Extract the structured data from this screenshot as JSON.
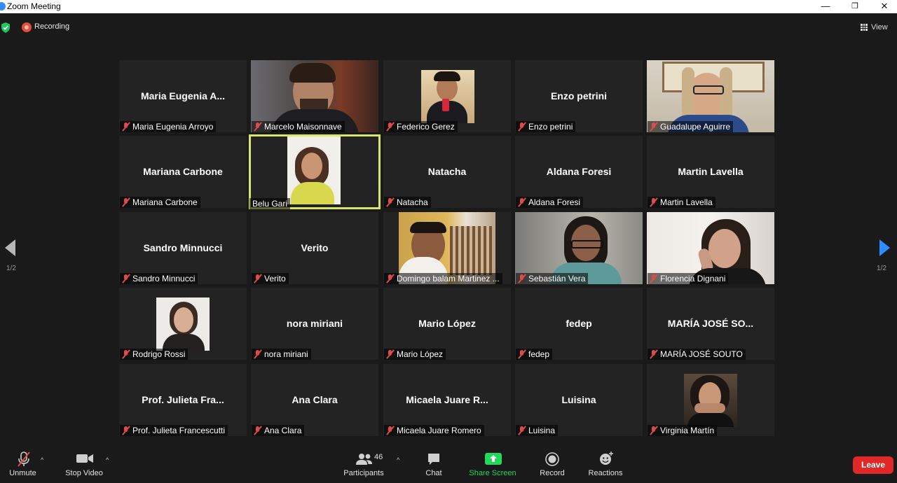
{
  "window": {
    "title": "Zoom Meeting",
    "minimize_icon": "—",
    "restore_icon": "❐",
    "close_icon": "✕"
  },
  "meeting": {
    "recording_label": "Recording",
    "view_label": "View"
  },
  "pagination": {
    "left": "1/2",
    "right": "1/2"
  },
  "participants": [
    {
      "big": "Maria Eugenia A...",
      "name": "Maria Eugenia Arroyo",
      "video": false
    },
    {
      "big": "",
      "name": "Marcelo Maisonnave",
      "video": true
    },
    {
      "big": "",
      "name": "Federico Gerez",
      "video": true
    },
    {
      "big": "Enzo petrini",
      "name": "Enzo petrini",
      "video": false
    },
    {
      "big": "",
      "name": "Guadalupe Aguirre",
      "video": true
    },
    {
      "big": "Mariana Carbone",
      "name": "Mariana Carbone",
      "video": false
    },
    {
      "big": "",
      "name": "Belu Gari",
      "video": true,
      "active_speaker": true
    },
    {
      "big": "Natacha",
      "name": "Natacha",
      "video": false
    },
    {
      "big": "Aldana Foresi",
      "name": "Aldana Foresi",
      "video": false
    },
    {
      "big": "Martin Lavella",
      "name": "Martin Lavella",
      "video": false
    },
    {
      "big": "Sandro Minnucci",
      "name": "Sandro Minnucci",
      "video": false
    },
    {
      "big": "Verito",
      "name": "Verito",
      "video": false
    },
    {
      "big": "",
      "name": "Domingo balam Martinez ...",
      "video": true
    },
    {
      "big": "",
      "name": "Sebastián Vera",
      "video": true
    },
    {
      "big": "",
      "name": "Florencia Dignani",
      "video": true
    },
    {
      "big": "",
      "name": "Rodrigo Rossi",
      "video": true
    },
    {
      "big": "nora miriani",
      "name": "nora miriani",
      "video": false
    },
    {
      "big": "Mario López",
      "name": "Mario López",
      "video": false
    },
    {
      "big": "fedep",
      "name": "fedep",
      "video": false
    },
    {
      "big": "MARÍA JOSÉ SO...",
      "name": "MARÍA JOSÉ SOUTO",
      "video": false
    },
    {
      "big": "Prof. Julieta Fra...",
      "name": "Prof. Julieta Francescutti",
      "video": false
    },
    {
      "big": "Ana Clara",
      "name": "Ana Clara",
      "video": false
    },
    {
      "big": "Micaela Juare R...",
      "name": "Micaela Juare Romero",
      "video": false
    },
    {
      "big": "Luisina",
      "name": "Luisina",
      "video": false
    },
    {
      "big": "",
      "name": "Virginia Martín",
      "video": true
    }
  ],
  "toolbar": {
    "unmute": "Unmute",
    "stop_video": "Stop Video",
    "participants": "Participants",
    "participants_count": "46",
    "chat": "Chat",
    "share_screen": "Share Screen",
    "record": "Record",
    "reactions": "Reactions",
    "leave": "Leave",
    "caret": "^"
  },
  "colors": {
    "accent": "#2d8cff",
    "share": "#23d959",
    "leave": "#e02828",
    "active_border": "#d6e56b",
    "muted_mic": "#e04a4a"
  }
}
